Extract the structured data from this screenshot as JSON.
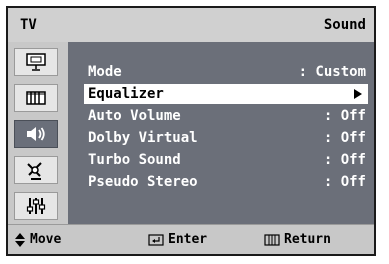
{
  "header": {
    "source_label": "TV",
    "menu_title": "Sound"
  },
  "sidebar": {
    "items": [
      {
        "icon": "picture-icon"
      },
      {
        "icon": "channel-icon"
      },
      {
        "icon": "sound-icon",
        "active": true
      },
      {
        "icon": "antenna-icon"
      },
      {
        "icon": "setup-icon"
      }
    ]
  },
  "menu": {
    "rows": [
      {
        "label": "Mode",
        "value": ": Custom"
      },
      {
        "label": "Equalizer",
        "value": ""
      },
      {
        "label": "Auto Volume",
        "value": ": Off"
      },
      {
        "label": "Dolby Virtual",
        "value": ": Off"
      },
      {
        "label": "Turbo Sound",
        "value": ": Off"
      },
      {
        "label": "Pseudo Stereo",
        "value": ": Off"
      }
    ],
    "selected_index": 1
  },
  "footer": {
    "move_label": "Move",
    "enter_label": "Enter",
    "return_label": "Return"
  }
}
